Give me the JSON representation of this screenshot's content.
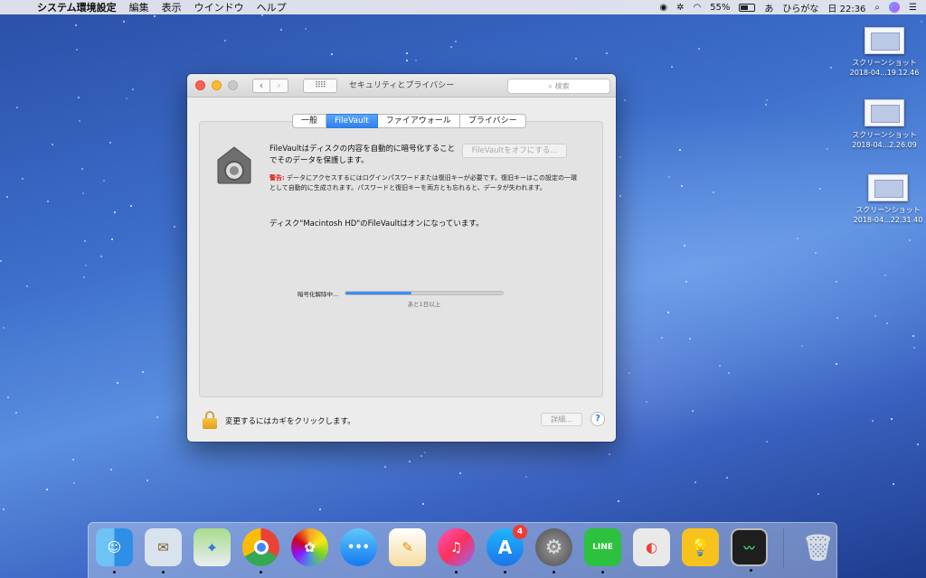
{
  "menubar": {
    "app_name": "システム環境設定",
    "menus": [
      "編集",
      "表示",
      "ウインドウ",
      "ヘルプ"
    ],
    "battery": "55%",
    "input_mode": "ひらがな",
    "clock": "日 22:36",
    "status_icons": [
      "line-icon",
      "accessibility-icon",
      "wifi-icon",
      "battery-icon",
      "input-icon",
      "search-icon",
      "siri-icon"
    ]
  },
  "desktop": {
    "files": [
      {
        "name": "スクリーンショット",
        "date": "2018-04...19.12.46"
      },
      {
        "name": "スクリーンショット",
        "date": "2018-04...2.26.09"
      },
      {
        "name": "スクリーンショット",
        "date": "2018-04...22.31.40"
      }
    ]
  },
  "window": {
    "title": "セキュリティとプライバシー",
    "search_placeholder": "検索",
    "tabs": [
      {
        "label": "一般",
        "active": false
      },
      {
        "label": "FileVault",
        "active": true
      },
      {
        "label": "ファイアウォール",
        "active": false
      },
      {
        "label": "プライバシー",
        "active": false
      }
    ],
    "filevault": {
      "description": "FileVaultはディスクの内容を自動的に暗号化することでそのデータを保護します。",
      "turn_off_button": "FileVaultをオフにする...",
      "warning_label": "警告:",
      "warning_text": "データにアクセスするにはログインパスワードまたは復旧キーが必要です。復旧キーはこの設定の一環として自動的に生成されます。パスワードと復旧キーを両方とも忘れると、データが失われます。",
      "status": "ディスク\"Macintosh HD\"のFileVaultはオンになっています。",
      "progress_label": "暗号化解除中...",
      "progress_fraction": 0.42,
      "progress_remaining": "あと1日以上"
    },
    "footer": {
      "lock_text": "変更するにはカギをクリックします。",
      "advanced_button": "詳細...",
      "help_button": "?"
    }
  },
  "dock": {
    "apps": [
      {
        "name": "Finder",
        "icon": "finder-icon",
        "running": true,
        "glyph": "☺"
      },
      {
        "name": "Mail",
        "icon": "mail-icon",
        "running": true,
        "glyph": "✉"
      },
      {
        "name": "Maps",
        "icon": "maps-icon",
        "running": false,
        "glyph": "⌖"
      },
      {
        "name": "Chrome",
        "icon": "chrome-icon",
        "running": true,
        "glyph": ""
      },
      {
        "name": "Photos",
        "icon": "photos-icon",
        "running": false,
        "glyph": "✿"
      },
      {
        "name": "Messages",
        "icon": "messages-icon",
        "running": false,
        "glyph": "•••"
      },
      {
        "name": "Pages",
        "icon": "pages-icon",
        "running": false,
        "glyph": "✎"
      },
      {
        "name": "iTunes",
        "icon": "itunes-icon",
        "running": true,
        "glyph": "♫"
      },
      {
        "name": "App Store",
        "icon": "app-store-icon",
        "running": true,
        "glyph": "A",
        "badge": "4"
      },
      {
        "name": "System Preferences",
        "icon": "system-preferences-icon",
        "running": true,
        "glyph": "⚙"
      },
      {
        "name": "LINE",
        "icon": "line-app-icon",
        "running": true,
        "glyph": "LINE"
      },
      {
        "name": "Chrome Apps",
        "icon": "chrome-apps-icon",
        "running": false,
        "glyph": "◐"
      },
      {
        "name": "Tips",
        "icon": "tips-icon",
        "running": false,
        "glyph": "💡"
      },
      {
        "name": "Activity Monitor",
        "icon": "activity-monitor-icon",
        "running": true,
        "glyph": "〰"
      }
    ],
    "trash": {
      "name": "Trash",
      "icon": "trash-icon",
      "glyph": "🗑"
    }
  }
}
